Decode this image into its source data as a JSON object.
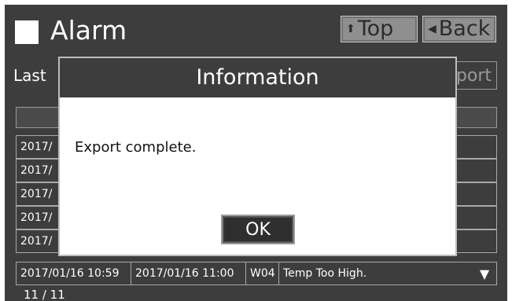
{
  "header": {
    "title": "Alarm",
    "top_button": "Top",
    "back_button": "Back"
  },
  "filter": {
    "last_label": "Last",
    "export_button": "port"
  },
  "rows_partial": [
    {
      "date": "2017/"
    },
    {
      "date": "2017/"
    },
    {
      "date": "2017/"
    },
    {
      "date": "2017/"
    },
    {
      "date": "2017/"
    }
  ],
  "row_full": {
    "occurred": "2017/01/16 10:59",
    "recovered": "2017/01/16 11:00",
    "code": "W04",
    "message": "Temp Too High."
  },
  "pagination": "11 / 11",
  "dialog": {
    "title": "Information",
    "message": "Export complete.",
    "ok_button": "OK"
  },
  "icons": {
    "top": "up-arrow-icon",
    "back": "left-triangle-icon",
    "scroll": "down-triangle-icon"
  }
}
